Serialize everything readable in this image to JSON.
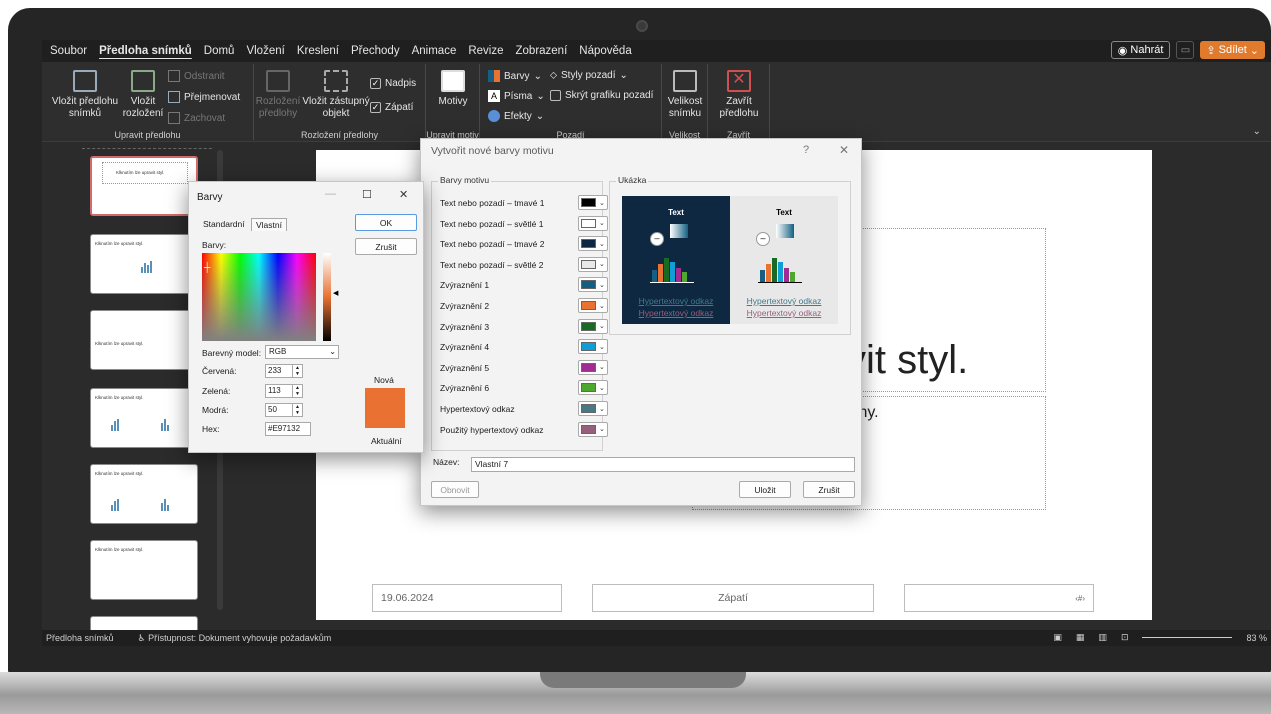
{
  "menu": {
    "items": [
      "Soubor",
      "Předloha snímků",
      "Domů",
      "Vložení",
      "Kreslení",
      "Přechody",
      "Animace",
      "Revize",
      "Zobrazení",
      "Nápověda"
    ],
    "active_index": 1,
    "record_label": "Nahrát",
    "share_label": "Sdílet"
  },
  "ribbon": {
    "insert_master": "Vložit předlohu snímků",
    "insert_layout": "Vložit rozložení",
    "delete": "Odstranit",
    "rename": "Přejmenovat",
    "preserve": "Zachovat",
    "group_edit": "Upravit předlohu",
    "master_layout": "Rozložení předlohy",
    "insert_placeholder": "Vložit zástupný objekt",
    "title_chk": "Nadpis",
    "footer_chk": "Zápatí",
    "group_layout": "Rozložení předlohy",
    "themes": "Motivy",
    "group_theme": "Upravit motiv",
    "colors": "Barvy",
    "fonts": "Písma",
    "effects": "Efekty",
    "bg_styles": "Styly pozadí",
    "hide_bg": "Skrýt grafiku pozadí",
    "group_bg": "Pozadí",
    "slide_size": "Velikost snímku",
    "group_size": "Velikost",
    "close_master": "Zavřít předlohu",
    "group_close": "Zavřít"
  },
  "thumbs": {
    "title_text": "Klknutím lze upravit styl."
  },
  "slide": {
    "title_fragment": "vit styl.",
    "subtitle_fragment": "lohy.",
    "footer_date": "19.06.2024",
    "footer_text": "Zápatí",
    "footer_num": "‹#›"
  },
  "status": {
    "mode": "Předloha snímků",
    "accessibility": "Přístupnost: Dokument vyhovuje požadavkům",
    "zoom": "83 %"
  },
  "theme_dialog": {
    "title": "Vytvořit nové barvy motivu",
    "group_colors": "Barvy motivu",
    "group_preview": "Ukázka",
    "rows": [
      {
        "label": "Text nebo pozadí – tmavé 1",
        "color": "#000000"
      },
      {
        "label": "Text nebo pozadí – světlé 1",
        "color": "#FFFFFF"
      },
      {
        "label": "Text nebo pozadí – tmavé 2",
        "color": "#0E2841"
      },
      {
        "label": "Text nebo pozadí – světlé 2",
        "color": "#E8E8E8"
      },
      {
        "label": "Zvýraznění 1",
        "color": "#156082"
      },
      {
        "label": "Zvýraznění 2",
        "color": "#E97132"
      },
      {
        "label": "Zvýraznění 3",
        "color": "#196B24"
      },
      {
        "label": "Zvýraznění 4",
        "color": "#0F9ED5"
      },
      {
        "label": "Zvýraznění 5",
        "color": "#A02B93"
      },
      {
        "label": "Zvýraznění 6",
        "color": "#4EA72E"
      },
      {
        "label": "Hypertextový odkaz",
        "color": "#467886"
      },
      {
        "label": "Použitý hypertextový odkaz",
        "color": "#96607D"
      }
    ],
    "preview_text": "Text",
    "hyperlink": "Hypertextový odkaz",
    "followed": "Hypertextový odkaz",
    "name_label": "Název:",
    "name_value": "Vlastní 7",
    "reset": "Obnovit",
    "save": "Uložit",
    "cancel": "Zrušit",
    "help": "?",
    "close": "✕"
  },
  "color_dialog": {
    "title": "Barvy",
    "tab_standard": "Standardní",
    "tab_custom": "Vlastní",
    "colors_label": "Barvy:",
    "model_label": "Barevný model:",
    "model_value": "RGB",
    "red_label": "Červená:",
    "red": "233",
    "green_label": "Zelená:",
    "green": "113",
    "blue_label": "Modrá:",
    "blue": "50",
    "hex_label": "Hex:",
    "hex": "#E97132",
    "ok": "OK",
    "cancel": "Zrušit",
    "new_label": "Nová",
    "current_label": "Aktuální"
  }
}
